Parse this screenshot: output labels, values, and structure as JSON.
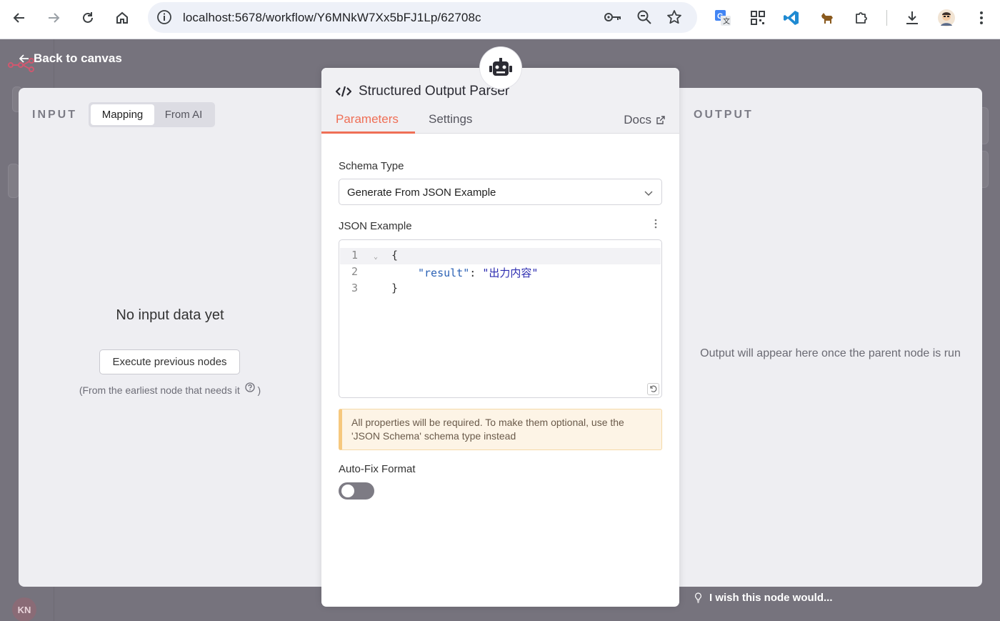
{
  "browser": {
    "url": "localhost:5678/workflow/Y6MNkW7Xx5bFJ1Lp/62708c"
  },
  "canvas": {
    "back_label": "Back to canvas",
    "avatar_initials": "KN",
    "feedback_label": "I wish this node would..."
  },
  "input_panel": {
    "heading": "INPUT",
    "modes": [
      "Mapping",
      "From AI"
    ],
    "active_mode": "Mapping",
    "empty_title": "No input data yet",
    "execute_label": "Execute previous nodes",
    "hint": "(From the earliest node that needs it",
    "hint_end": ")"
  },
  "node": {
    "title": "Structured Output Parser",
    "tabs": [
      "Parameters",
      "Settings"
    ],
    "active_tab": "Parameters",
    "docs_label": "Docs",
    "schema_type_label": "Schema Type",
    "schema_type_value": "Generate From JSON Example",
    "json_example_label": "JSON Example",
    "code_line_numbers": [
      "1",
      "2",
      "3"
    ],
    "code": {
      "open": "{",
      "key": "\"result\"",
      "colon": ": ",
      "value": "\"出力内容\"",
      "close": "}"
    },
    "notice": "All properties will be required. To make them optional, use the 'JSON Schema' schema type instead",
    "autofix_label": "Auto-Fix Format",
    "autofix_enabled": false
  },
  "output_panel": {
    "heading": "OUTPUT",
    "empty_message": "Output will appear here once the parent node is run"
  },
  "colors": {
    "accent": "#ef6f56",
    "backdrop": "#76737d",
    "notice_border": "#f6c87e"
  }
}
